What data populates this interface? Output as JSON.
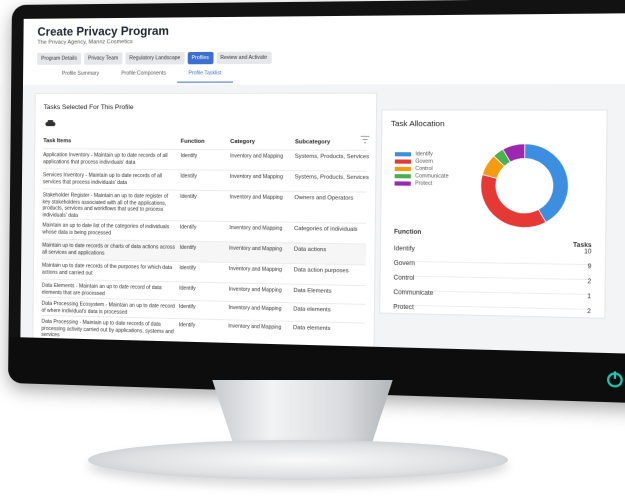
{
  "page": {
    "title": "Create Privacy Program",
    "subtitle": "The Privacy Agency, Mannz Cosmetics"
  },
  "steps": [
    {
      "label": "Program Details",
      "active": false
    },
    {
      "label": "Privacy Team",
      "active": false
    },
    {
      "label": "Regulatory Landscape",
      "active": false
    },
    {
      "label": "Profiles",
      "active": true
    },
    {
      "label": "Review and Activate",
      "active": false
    }
  ],
  "subtabs": [
    {
      "label": "Profile Summary",
      "active": false
    },
    {
      "label": "Profile Components",
      "active": false
    },
    {
      "label": "Profile Tasklist",
      "active": true
    }
  ],
  "tasks_panel": {
    "title": "Tasks Selected For This Profile",
    "columns": {
      "task": "Task Items",
      "function": "Function",
      "category": "Category",
      "subcategory": "Subcategory"
    },
    "rows": [
      {
        "task": "Application Inventory - Maintain up to date records of all applications that process individuals' data",
        "function": "Identify",
        "category": "Inventory and Mapping",
        "subcategory": "Systems, Products, Services"
      },
      {
        "task": "Services Inventory - Maintain up to date records of all services that process individuals' data",
        "function": "Identify",
        "category": "Inventory and Mapping",
        "subcategory": "Systems, Products, Services"
      },
      {
        "task": "Stakeholder Register - Maintain an up to date register of key stakeholders associated with all of the applications, products, services and workflows that used to process individuals' data",
        "function": "Identify",
        "category": "Inventory and Mapping",
        "subcategory": "Owners and Operators"
      },
      {
        "task": "Maintain an up to date list of the categories of individuals whose data is being processed",
        "function": "Identify",
        "category": "Inventory and Mapping",
        "subcategory": "Categories of individuals"
      },
      {
        "task": "Maintain up to date records or charts of data actions across all services and applications",
        "function": "Identify",
        "category": "Inventory and Mapping",
        "subcategory": "Data actions"
      },
      {
        "task": "Maintain up to date records of the purposes for which data actions and carried out",
        "function": "Identify",
        "category": "Inventory and Mapping",
        "subcategory": "Data action purposes"
      },
      {
        "task": "Data Elements - Maintain an up to date record of data elements that are processed",
        "function": "Identify",
        "category": "Inventory and Mapping",
        "subcategory": "Data Elements"
      },
      {
        "task": "Data Processing Ecosystem - Maintain an up to date record of where individual's data is processed",
        "function": "Identify",
        "category": "Inventory and Mapping",
        "subcategory": "Data elements"
      },
      {
        "task": "Data Processing - Maintain up to date records of data processing activity carried out by applications, systems and services",
        "function": "Identify",
        "category": "Inventory and Mapping",
        "subcategory": "Data elements"
      }
    ]
  },
  "allocation": {
    "title": "Task Allocation",
    "legend": [
      {
        "label": "Identify",
        "color": "#3b8ee0"
      },
      {
        "label": "Govern",
        "color": "#e53935"
      },
      {
        "label": "Control",
        "color": "#f39c12"
      },
      {
        "label": "Communicate",
        "color": "#4caf50"
      },
      {
        "label": "Protect",
        "color": "#9c27b0"
      }
    ],
    "table_head": {
      "function": "Function",
      "tasks": "Tasks"
    },
    "rows": [
      {
        "function": "Identify",
        "tasks": "10"
      },
      {
        "function": "Govern",
        "tasks": "9"
      },
      {
        "function": "Control",
        "tasks": "2"
      },
      {
        "function": "Communicate",
        "tasks": "1"
      },
      {
        "function": "Protect",
        "tasks": "2"
      }
    ],
    "donut_values": [
      10,
      9,
      2,
      1,
      2
    ]
  }
}
